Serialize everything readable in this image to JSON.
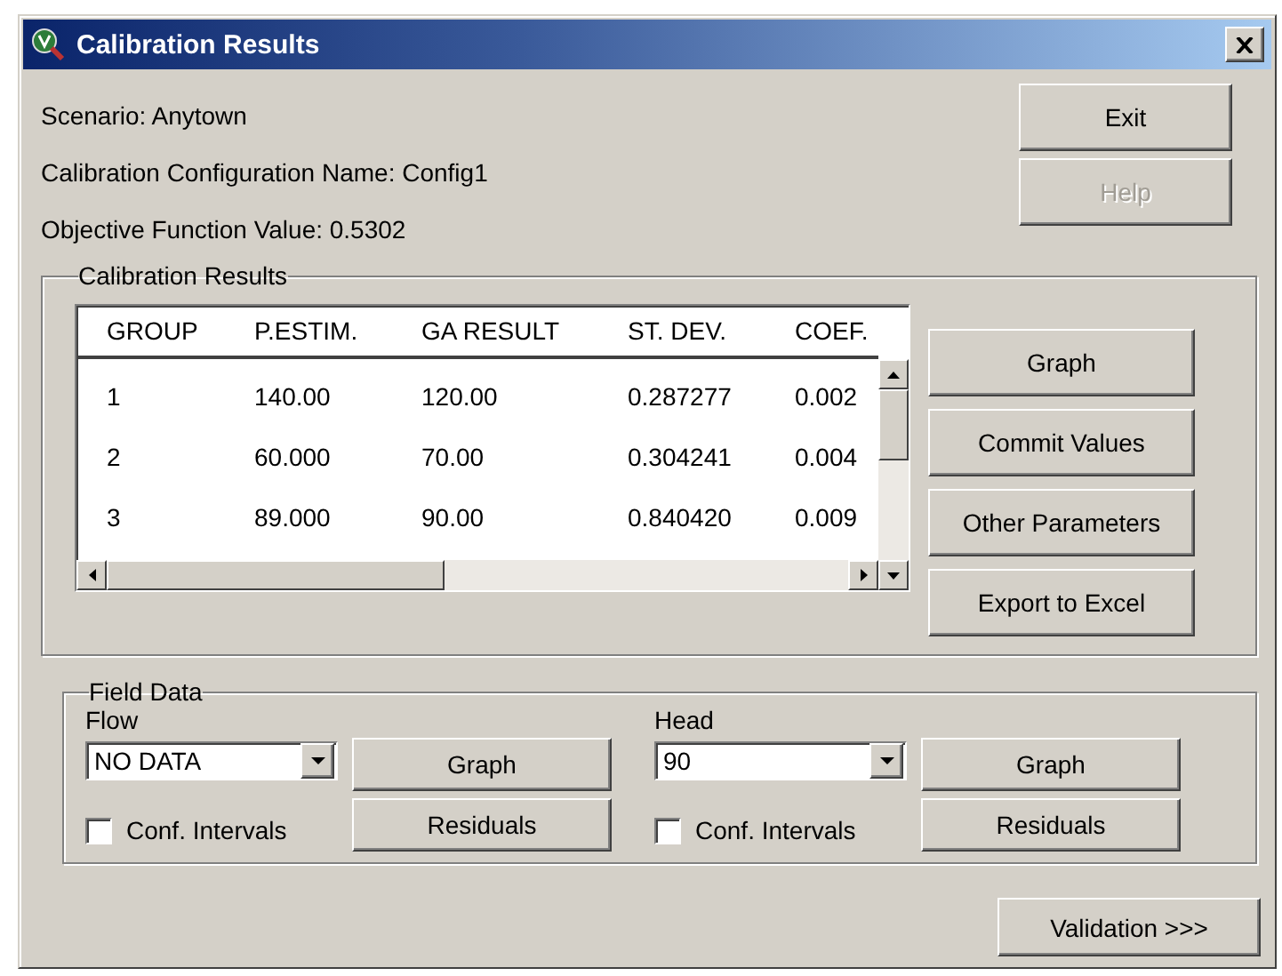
{
  "window": {
    "title": "Calibration Results"
  },
  "info": [
    "Scenario: Anytown",
    "Calibration Configuration Name: Config1",
    "Objective Function Value: 0.5302"
  ],
  "top_buttons": [
    {
      "label": "Exit",
      "disabled": false
    },
    {
      "label": "Help",
      "disabled": true
    }
  ],
  "calibration_results": {
    "title": "Calibration Results",
    "columns": [
      "GROUP",
      "P.ESTIM.",
      "GA RESULT",
      "ST. DEV.",
      "COEF."
    ],
    "rows": [
      [
        "1",
        "140.00",
        "120.00",
        "0.287277",
        "0.002"
      ],
      [
        "2",
        "60.000",
        "70.00",
        "0.304241",
        "0.004"
      ],
      [
        "3",
        "89.000",
        "90.00",
        "0.840420",
        "0.009"
      ]
    ],
    "buttons": [
      "Graph",
      "Commit Values",
      "Other Parameters",
      "Export to Excel"
    ]
  },
  "field_data": {
    "title": "Field Data",
    "groups": [
      {
        "label": "Flow",
        "value": "NO DATA",
        "conf_label": "Conf. Intervals",
        "checked": false,
        "buttons": [
          "Graph",
          "Residuals"
        ]
      },
      {
        "label": "Head",
        "value": "90",
        "conf_label": "Conf. Intervals",
        "checked": false,
        "buttons": [
          "Graph",
          "Residuals"
        ]
      }
    ]
  },
  "validation_button": "Validation >>>"
}
